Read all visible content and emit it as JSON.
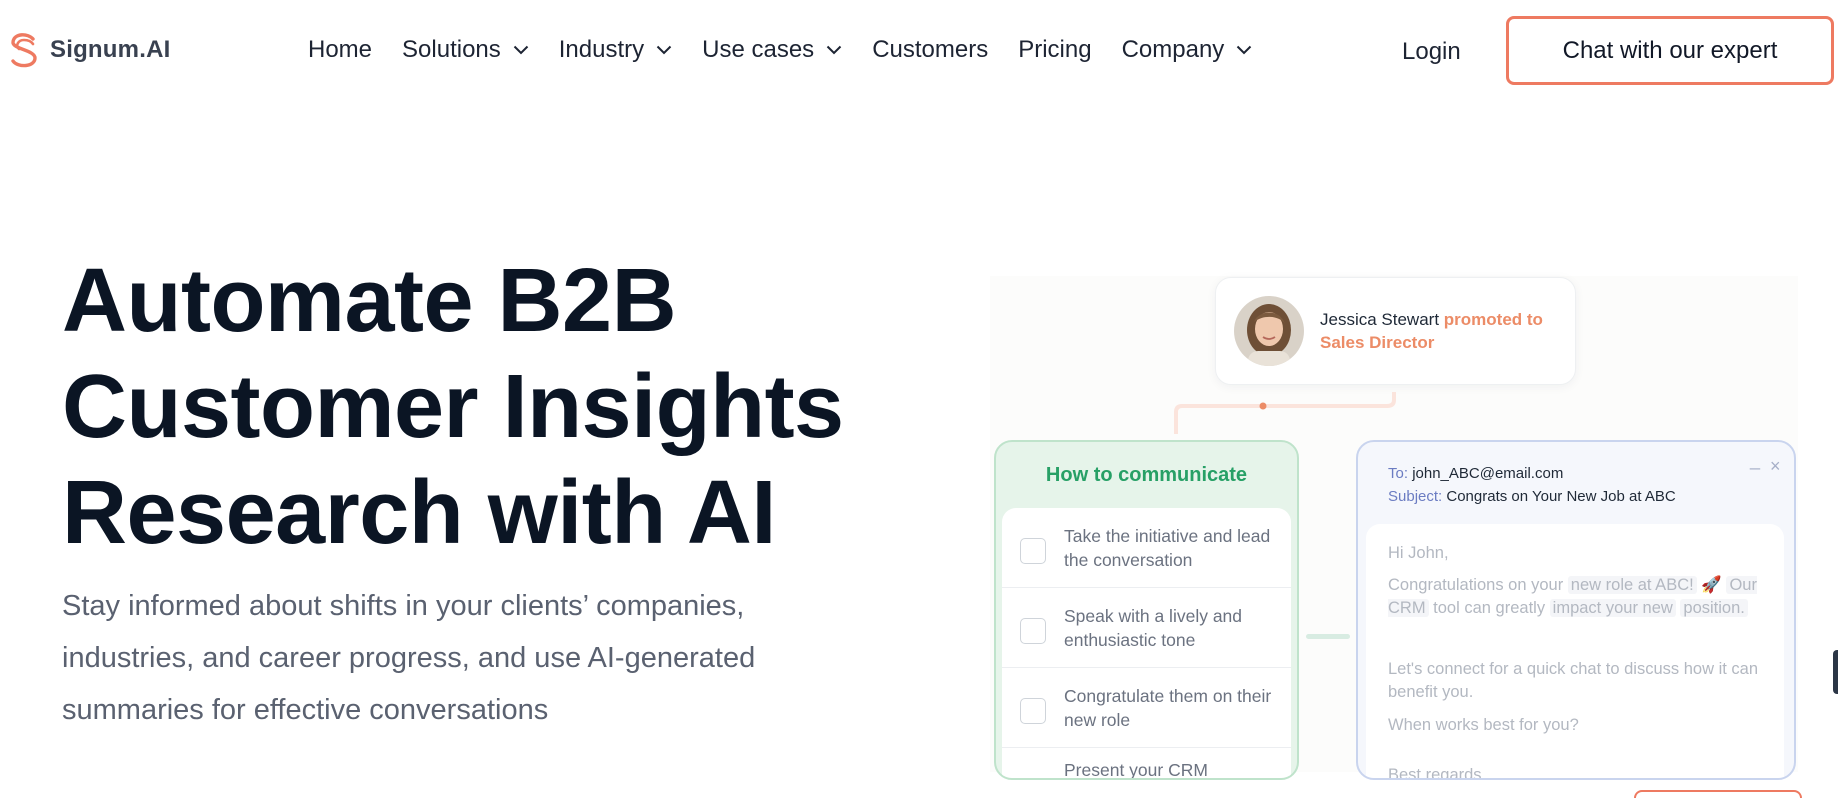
{
  "brand": {
    "name": "Signum.AI",
    "accent": "#ee7a61"
  },
  "nav": {
    "items": [
      {
        "label": "Home",
        "dropdown": false
      },
      {
        "label": "Solutions",
        "dropdown": true
      },
      {
        "label": "Industry",
        "dropdown": true
      },
      {
        "label": "Use cases",
        "dropdown": true
      },
      {
        "label": "Customers",
        "dropdown": false
      },
      {
        "label": "Pricing",
        "dropdown": false
      },
      {
        "label": "Company",
        "dropdown": true
      }
    ],
    "login": "Login",
    "cta": "Chat with our expert"
  },
  "hero": {
    "title_lines": [
      "Automate B2B",
      "Customer Insights",
      "Research with AI"
    ],
    "subtitle": "Stay informed about shifts in your clients’ companies, industries, and career progress, and use AI-generated summaries for effective conversations"
  },
  "illustration": {
    "profile": {
      "name": "Jessica Stewart",
      "update": "promoted to Sales Director"
    },
    "how_to_communicate": {
      "title": "How to communicate",
      "items": [
        "Take the initiative and lead the conversation",
        "Speak with a lively and enthusiastic tone",
        "Congratulate them on their new role"
      ],
      "partial_item": "Present your CRM"
    },
    "email": {
      "to_label": "To:",
      "to": "john_ABC@email.com",
      "subject_label": "Subject:",
      "subject": "Congrats on Your New Job at ABC",
      "controls": [
        "_",
        "×"
      ],
      "greeting": "Hi John,",
      "p1_a": "Congratulations on your",
      "p1_hl1": "new role at ABC!",
      "p1_emoji": "🚀",
      "p1_hl2": "Our CRM",
      "p1_b": "tool can greatly",
      "p1_hl3": "impact your new",
      "p1_hl4": "position.",
      "p2": "Let's connect for a quick chat to discuss how it can benefit you.",
      "p3": "When works best for you?",
      "signoff": "Best regards,"
    }
  }
}
